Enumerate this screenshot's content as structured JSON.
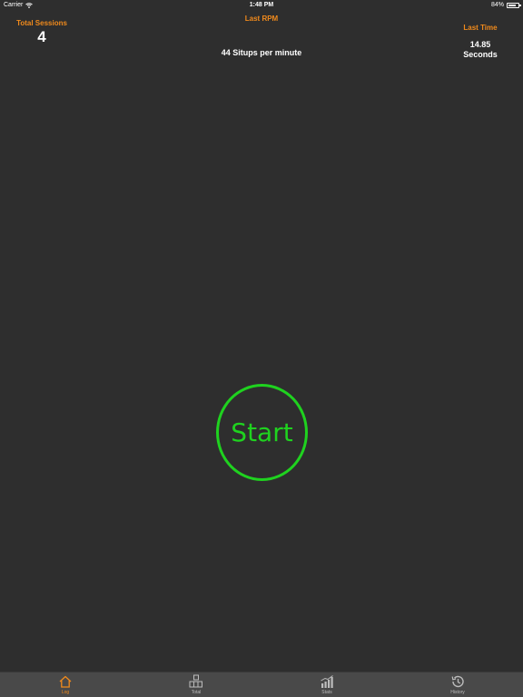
{
  "status_bar": {
    "carrier": "Carrier",
    "time": "1:48 PM",
    "battery": "84%",
    "battery_level": 0.84
  },
  "header": {
    "total_sessions_label": "Total Sessions",
    "total_sessions_value": "4",
    "last_rpm_label": "Last RPM",
    "last_rpm_value": "44 Situps per minute",
    "last_time_label": "Last Time",
    "last_time_value": "14.85",
    "last_time_unit": "Seconds"
  },
  "main": {
    "start_label": "Start"
  },
  "tabs": [
    {
      "label": "Log",
      "icon": "home-icon",
      "active": true
    },
    {
      "label": "Total",
      "icon": "total-icon",
      "active": false
    },
    {
      "label": "Stats",
      "icon": "stats-icon",
      "active": false
    },
    {
      "label": "History",
      "icon": "history-icon",
      "active": false
    }
  ],
  "colors": {
    "background": "#2e2e2e",
    "accent": "#f08a1c",
    "start": "#1fd21f",
    "tab_bar": "#494949"
  }
}
